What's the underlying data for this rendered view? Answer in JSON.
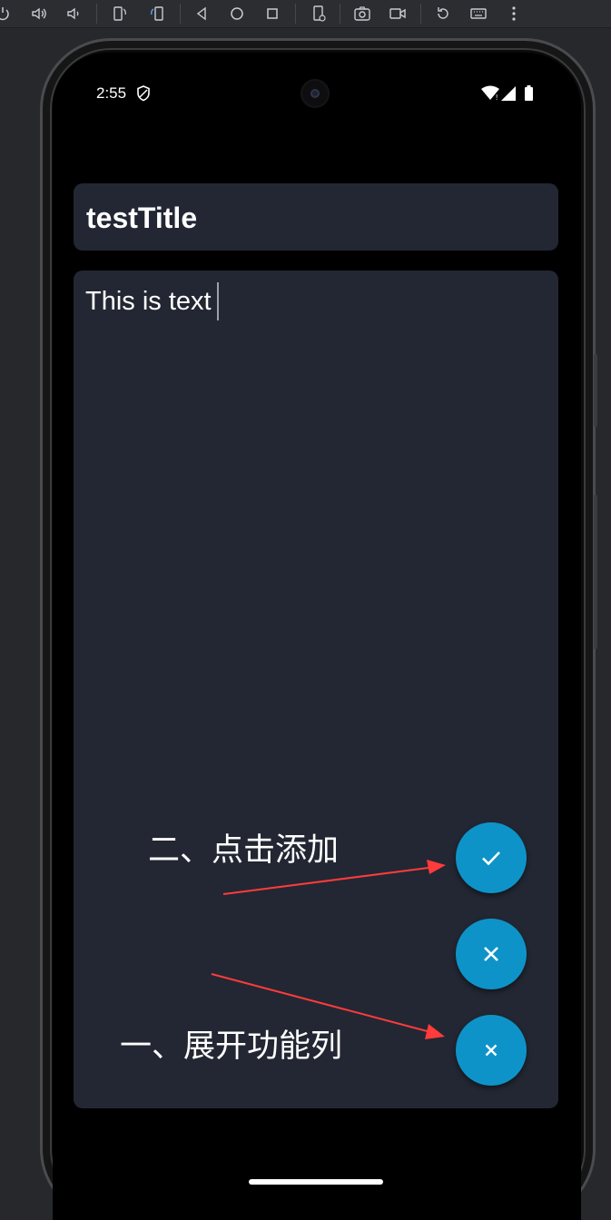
{
  "toolbar": {
    "buttons": [
      "power-icon",
      "volume-up-icon",
      "volume-down-icon",
      "rotate-left-icon",
      "rotate-right-icon",
      "back-icon",
      "home-icon",
      "overview-icon",
      "device-settings-icon",
      "screenshot-icon",
      "screen-record-icon",
      "reset-icon",
      "keyboard-icon",
      "more-icon"
    ]
  },
  "status_bar": {
    "time": "2:55"
  },
  "note": {
    "title": "testTitle",
    "body": "This is text"
  },
  "annotations": {
    "step2": "二、点击添加",
    "step1": "一、展开功能列"
  },
  "colors": {
    "card": "#222733",
    "fab": "#0e93c9",
    "arrow": "#ff3b3b"
  }
}
